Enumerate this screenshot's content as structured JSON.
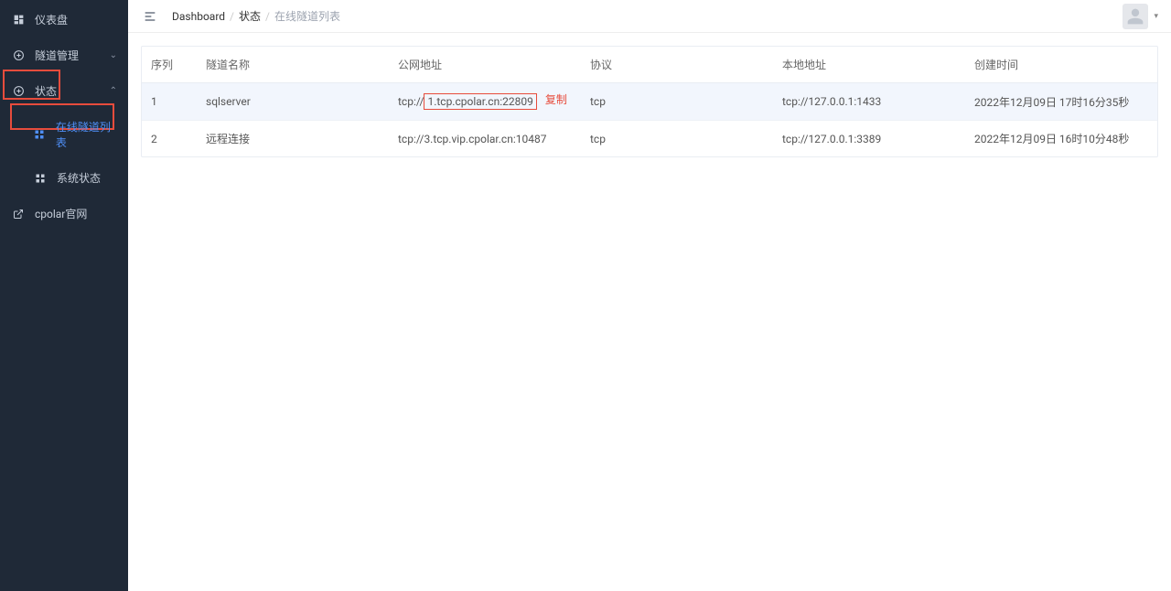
{
  "sidebar": {
    "items": [
      {
        "label": "仪表盘",
        "icon": "dashboard"
      },
      {
        "label": "隧道管理",
        "icon": "plus-circle",
        "chevron": true
      },
      {
        "label": "状态",
        "icon": "plus-circle",
        "chevron": true,
        "open": true
      },
      {
        "label": "在线隧道列表",
        "icon": "grid",
        "submenu": true,
        "active": true
      },
      {
        "label": "系统状态",
        "icon": "grid",
        "submenu": true
      },
      {
        "label": "cpolar官网",
        "icon": "external-link"
      }
    ]
  },
  "breadcrumb": {
    "items": [
      "Dashboard",
      "状态",
      "在线隧道列表"
    ]
  },
  "table": {
    "headers": {
      "seq": "序列",
      "name": "隧道名称",
      "public": "公网地址",
      "proto": "协议",
      "local": "本地地址",
      "time": "创建时间"
    },
    "rows": [
      {
        "seq": "1",
        "name": "sqlserver",
        "public_prefix": "tcp://",
        "public_host": "1.tcp.cpolar.cn:22809",
        "copy": "复制",
        "proto": "tcp",
        "local": "tcp://127.0.0.1:1433",
        "time": "2022年12月09日 17时16分35秒"
      },
      {
        "seq": "2",
        "name": "远程连接",
        "public_full": "tcp://3.tcp.vip.cpolar.cn:10487",
        "proto": "tcp",
        "local": "tcp://127.0.0.1:3389",
        "time": "2022年12月09日 16时10分48秒"
      }
    ]
  }
}
